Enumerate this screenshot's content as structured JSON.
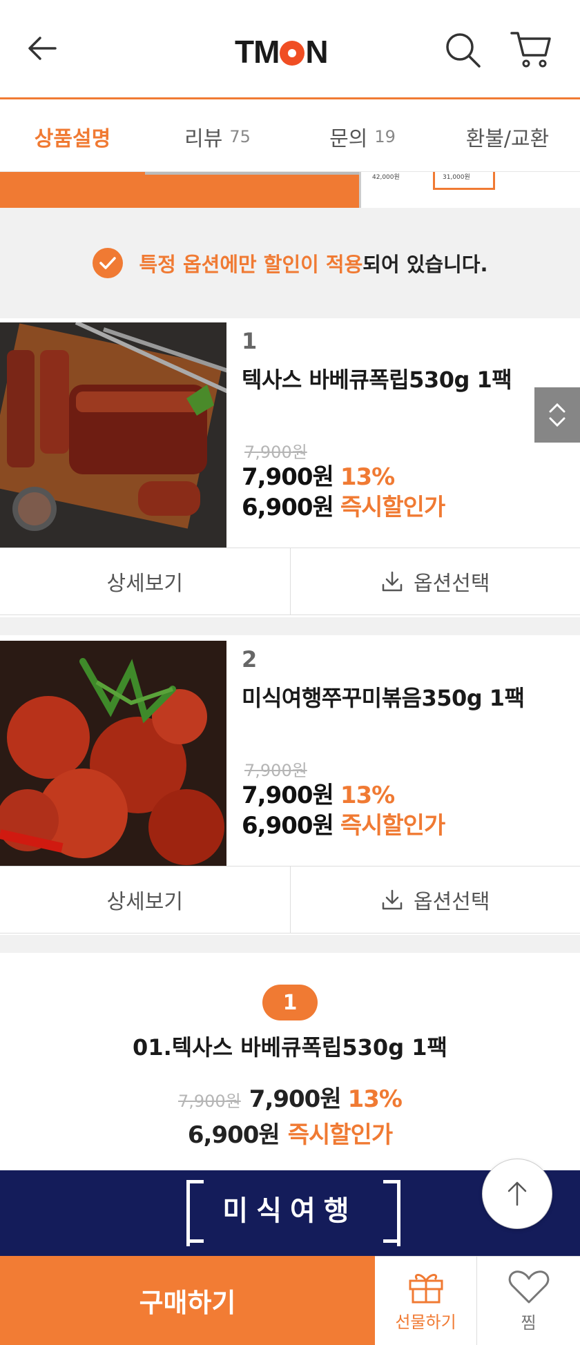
{
  "header": {
    "logo": "TMON"
  },
  "tabs": [
    {
      "label": "상품설명",
      "count": ""
    },
    {
      "label": "리뷰",
      "count": "75"
    },
    {
      "label": "문의",
      "count": "19"
    },
    {
      "label": "환불/교환",
      "count": ""
    }
  ],
  "banner_strip": {
    "price_a": "42,000원",
    "price_b": "31,000원"
  },
  "notice": {
    "highlight": "특정 옵션에만 할인이 적용",
    "rest": "되어 있습니다."
  },
  "products": [
    {
      "index": "1",
      "name": "텍사스 바베큐폭립530g 1팩",
      "original_price": "7,900원",
      "price": "7,900원",
      "discount": "13%",
      "sale_price": "6,900원",
      "sale_label": "즉시할인가",
      "detail_label": "상세보기",
      "option_label": "옵션선택"
    },
    {
      "index": "2",
      "name": "미식여행쭈꾸미볶음350g 1팩",
      "original_price": "7,900원",
      "price": "7,900원",
      "discount": "13%",
      "sale_price": "6,900원",
      "sale_label": "즉시할인가",
      "detail_label": "상세보기",
      "option_label": "옵션선택"
    }
  ],
  "summary": {
    "badge": "1",
    "title": "01.텍사스 바베큐폭립530g 1팩",
    "original_price": "7,900원",
    "price": "7,900원",
    "discount": "13%",
    "sale_price": "6,900원",
    "sale_label": "즉시할인가"
  },
  "brand_banner": {
    "text": "미식여행"
  },
  "bottom_bar": {
    "buy_label": "구매하기",
    "gift_label": "선물하기",
    "wish_label": "찜"
  },
  "colors": {
    "accent": "#f07a33",
    "banner_navy": "#141c5a"
  }
}
